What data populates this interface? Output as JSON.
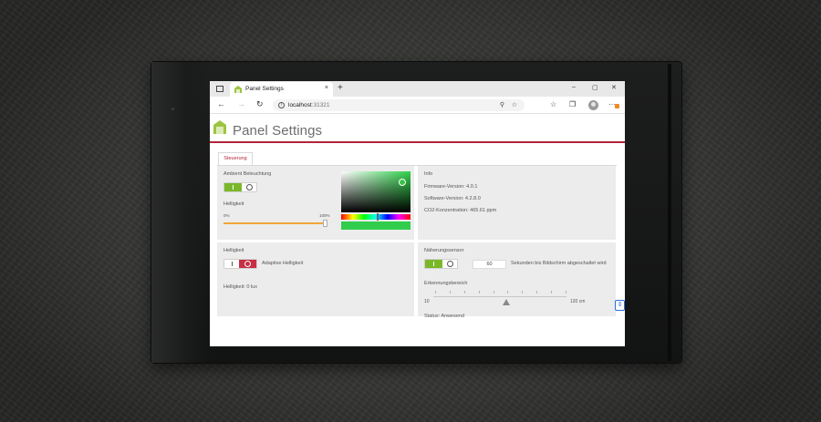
{
  "browser": {
    "tab_title": "Panel Settings",
    "tab_close": "×",
    "new_tab": "+",
    "window_controls": [
      "–",
      "▢",
      "✕"
    ],
    "url_host": "localhost",
    "url_port": ":31321",
    "nav": {
      "back": "←",
      "forward": "→",
      "refresh": "↻"
    },
    "toolbar_more": "···"
  },
  "page": {
    "title": "Panel Settings",
    "tabs": [
      {
        "label": "Steuerung",
        "active": true
      }
    ]
  },
  "ambient": {
    "label": "Ambient Beleuchtung",
    "toggle_on": true,
    "brightness_label": "Helligkeit",
    "min_label": "0%",
    "max_label": "100%",
    "brightness_value": 1.0,
    "selected_color": "#32cd4c"
  },
  "info": {
    "title": "Info",
    "firmware": "Firmware-Version: 4.0.1",
    "software": "Software-Version: 4.2.8.0",
    "co2": "CO2-Konzentration: 465.61 ppm"
  },
  "display": {
    "label": "Helligkeit",
    "adaptive_label": "Adaptive Helligkeit",
    "adaptive_on": false,
    "brightness_readout": "Helligkeit: 0 lux"
  },
  "proximity": {
    "label": "Näherungssensor",
    "toggle_on": true,
    "seconds_value": "60",
    "seconds_label": "Sekunden bis Bildschirm abgeschaltet wird",
    "range_label": "Erkennungsbereich",
    "range_min": "10",
    "range_max": "120 cm",
    "range_value_fraction": 0.55,
    "status": "Status: Anwesend"
  },
  "colors": {
    "accent_red": "#b0243a",
    "toggle_green": "#7ab829",
    "slider_orange": "#f0a63a"
  }
}
